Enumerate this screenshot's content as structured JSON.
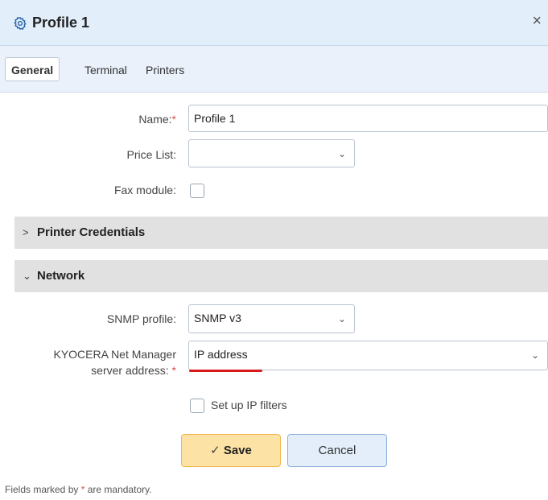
{
  "window": {
    "title": "Profile 1",
    "close_label": "×"
  },
  "tabs": [
    {
      "label": "General",
      "active": true
    },
    {
      "label": "Terminal",
      "active": false
    },
    {
      "label": "Printers",
      "active": false
    }
  ],
  "form": {
    "name_label": "Name:",
    "name_value": "Profile 1",
    "price_list_label": "Price List:",
    "price_list_value": "",
    "fax_label": "Fax module:",
    "fax_checked": false
  },
  "sections": {
    "printer_credentials": {
      "label": "Printer Credentials",
      "expanded": false
    },
    "network": {
      "label": "Network",
      "expanded": true
    }
  },
  "network": {
    "snmp_label": "SNMP profile:",
    "snmp_value": "SNMP v3",
    "kyocera_label_line1": "KYOCERA Net Manager",
    "kyocera_label_line2": "server address:",
    "kyocera_value": "IP address",
    "ip_filters_label": "Set up IP filters",
    "ip_filters_checked": false
  },
  "actions": {
    "save_label": "Save",
    "cancel_label": "Cancel"
  },
  "footer": {
    "note_prefix": "Fields marked by",
    "required_mark": "*",
    "note_suffix": "are mandatory."
  },
  "colors": {
    "required": "#d9534f",
    "save_bg": "#fde2a6",
    "titlebar_bg": "#e3eefb",
    "annotation_underline": "#d81a1a"
  }
}
